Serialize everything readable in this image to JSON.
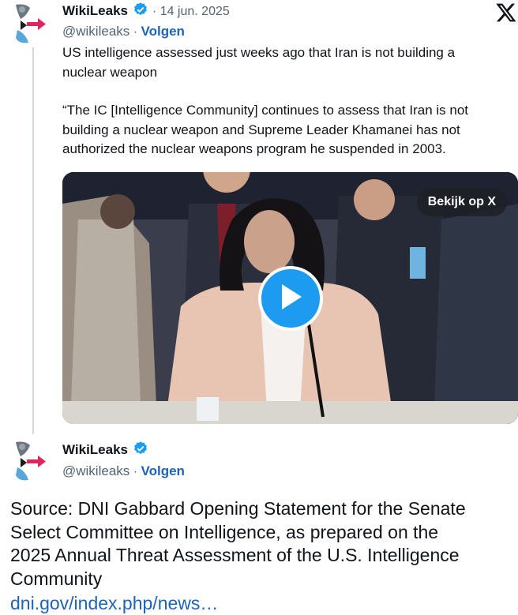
{
  "tweet1": {
    "name": "WikiLeaks",
    "date": "14 jun. 2025",
    "handle": "@wikileaks",
    "follow": "Volgen",
    "text1_line1": "US intelligence assessed just weeks ago that Iran is not building a",
    "text1_line2": "nuclear weapon",
    "text2_line1": "“The IC [Intelligence Community] continues to assess that Iran is not",
    "text2_line2": "building a nuclear weapon and Supreme Leader Khamanei has not",
    "text2_line3": "authorized the nuclear weapons program he suspended in 2003.",
    "video_badge": "Bekijk op X"
  },
  "tweet2": {
    "name": "WikiLeaks",
    "handle": "@wikileaks",
    "follow": "Volgen"
  },
  "source": {
    "line1": "Source: DNI Gabbard Opening Statement for the Senate",
    "line2": "Select Committee on Intelligence, as prepared on the",
    "line3": "2025 Annual Threat Assessment of the U.S. Intelligence",
    "line4": "Community",
    "link": "dni.gov/index.php/news…"
  },
  "colors": {
    "verified": "#1d9bf0",
    "link": "#1d63b8",
    "secondary_text": "#536471",
    "arrow": "#e0245e"
  },
  "icons": {
    "platform_logo": "x-logo-icon",
    "verified": "verified-badge-icon",
    "play": "play-icon",
    "avatar": "wikileaks-hourglass-logo"
  }
}
